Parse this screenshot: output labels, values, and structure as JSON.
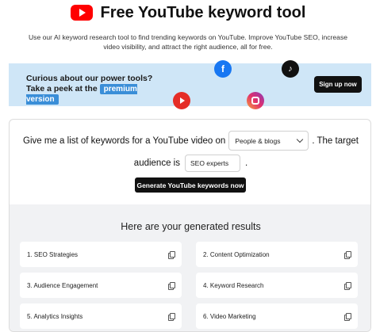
{
  "header": {
    "title": "Free YouTube keyword tool",
    "logo_icon": "youtube-logo-icon"
  },
  "subtitle": "Use our AI keyword research tool to find trending keywords on YouTube. Improve YouTube SEO, increase video visibility, and attract the right audience, all for free.",
  "promo": {
    "text": "Curious about our power tools? Take a peek at the",
    "badge": "premium version",
    "button": "Sign up now",
    "icons": [
      "facebook-icon",
      "tiktok-icon",
      "youtube-icon",
      "instagram-icon"
    ]
  },
  "form": {
    "prefix": "Give me a list of keywords for a YouTube video on",
    "category_value": "People & blogs",
    "middle": ". The target",
    "audience_label": "audience is",
    "audience_value": "SEO experts",
    "period": ".",
    "generate_button": "Generate YouTube keywords now"
  },
  "results": {
    "title": "Here are your generated results",
    "items": [
      "1. SEO Strategies",
      "2. Content Optimization",
      "3. Audience Engagement",
      "4. Keyword Research",
      "5. Analytics Insights",
      "6. Video Marketing"
    ]
  },
  "colors": {
    "brand_red": "#ff0000",
    "promo_bg": "#cfe6f7",
    "premium_badge": "#3a8ed8",
    "button_bg": "#111111"
  }
}
